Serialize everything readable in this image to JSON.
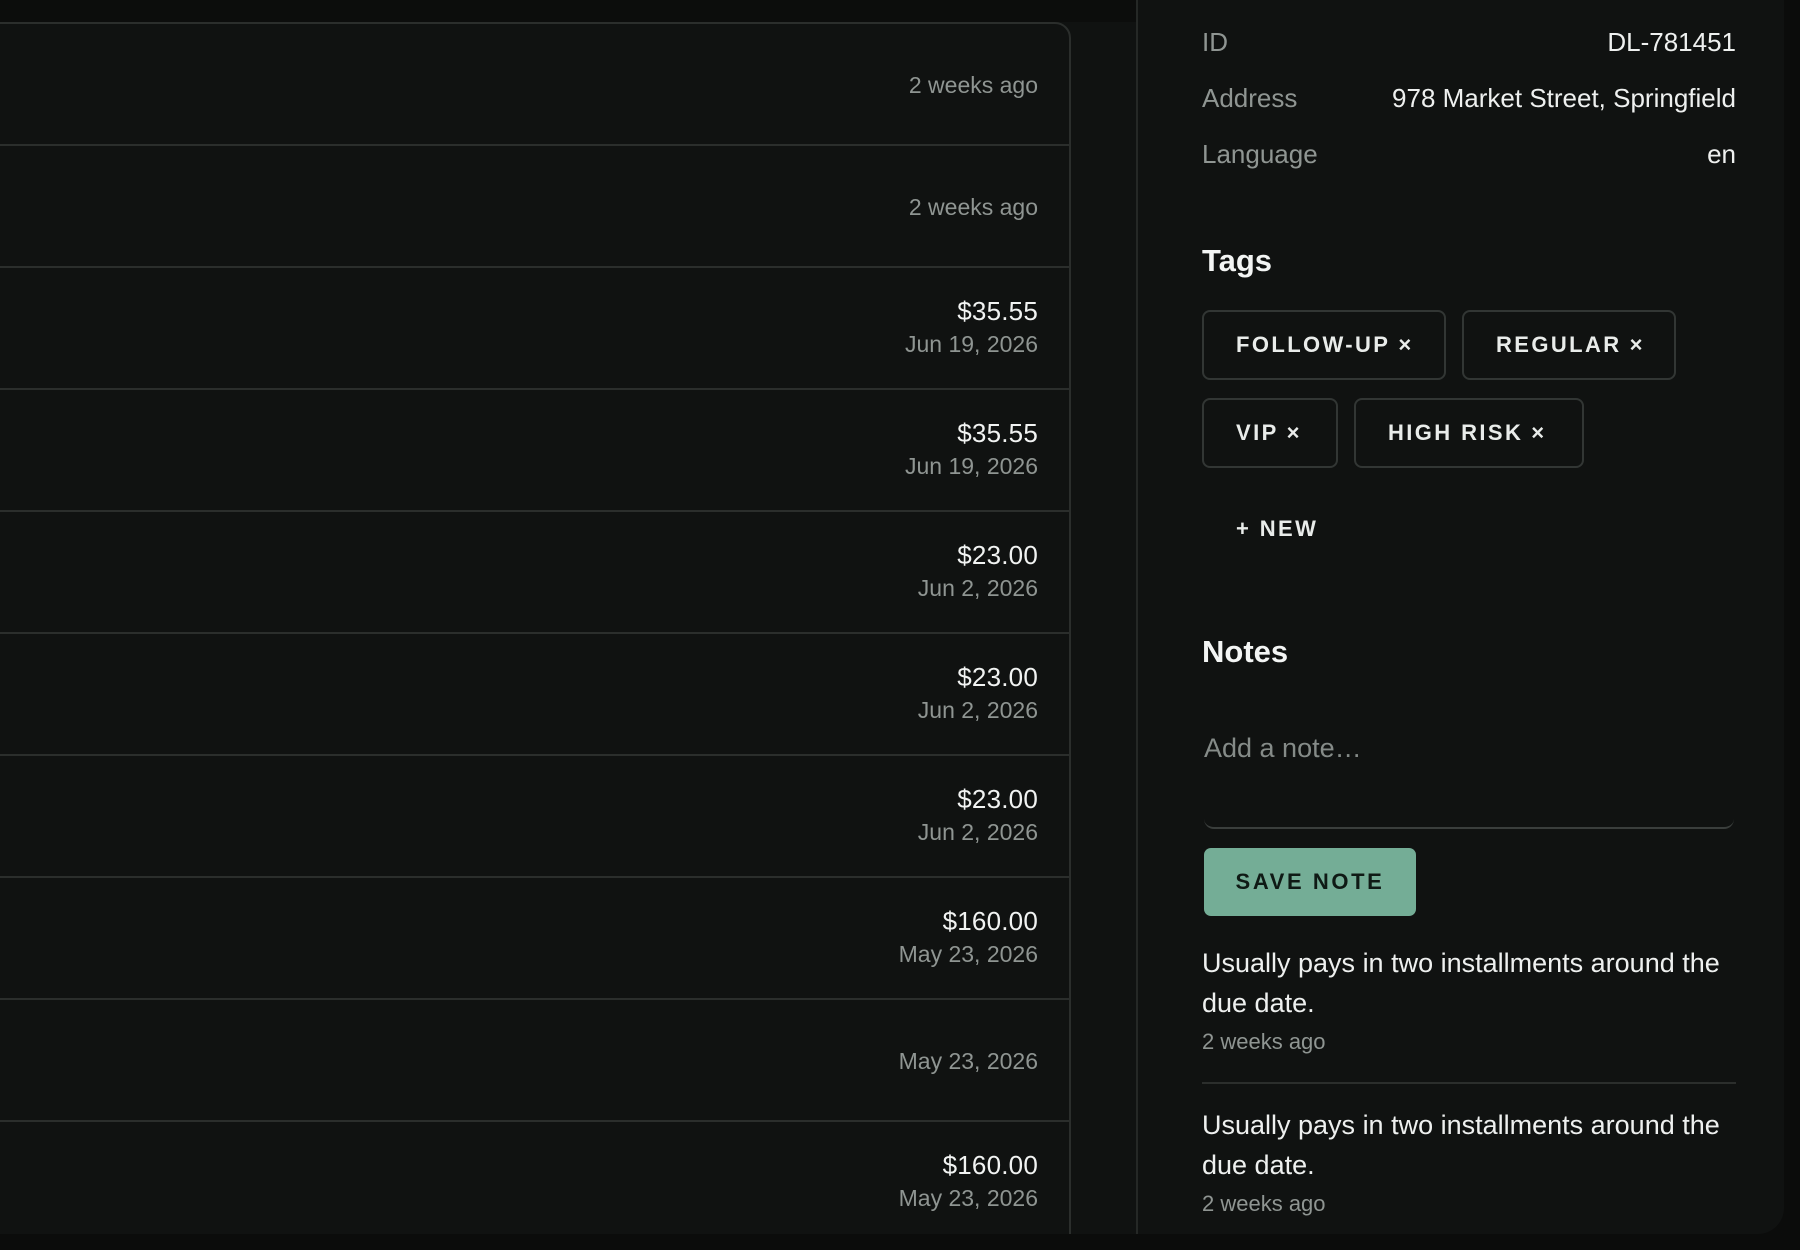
{
  "activity": {
    "rows": [
      {
        "amount": "",
        "date": "2 weeks ago"
      },
      {
        "amount": "",
        "date": "2 weeks ago"
      },
      {
        "amount": "$35.55",
        "date": "Jun 19, 2026"
      },
      {
        "amount": "$35.55",
        "date": "Jun 19, 2026"
      },
      {
        "amount": "$23.00",
        "date": "Jun 2, 2026"
      },
      {
        "amount": "$23.00",
        "date": "Jun 2, 2026"
      },
      {
        "amount": "$23.00",
        "date": "Jun 2, 2026"
      },
      {
        "amount": "$160.00",
        "date": "May 23, 2026"
      },
      {
        "amount": "",
        "date": "May 23, 2026"
      },
      {
        "amount": "$160.00",
        "date": "May 23, 2026"
      }
    ]
  },
  "details": {
    "fields": [
      {
        "key": "ID",
        "value": "DL-781451"
      },
      {
        "key": "Address",
        "value": "978 Market Street, Springfield"
      },
      {
        "key": "Language",
        "value": "en"
      }
    ]
  },
  "tags": {
    "heading": "Tags",
    "items": [
      {
        "label": "FOLLOW-UP",
        "remove": "×"
      },
      {
        "label": "REGULAR",
        "remove": "×"
      },
      {
        "label": "VIP",
        "remove": "×"
      },
      {
        "label": "HIGH RISK",
        "remove": "×"
      }
    ],
    "new_label": "+ NEW"
  },
  "notes": {
    "heading": "Notes",
    "placeholder": "Add a note…",
    "save_label": "SAVE NOTE",
    "items": [
      {
        "text": "Usually pays in two installments around the due date.",
        "time": "2 weeks ago"
      },
      {
        "text": "Usually pays in two installments around the due date.",
        "time": "2 weeks ago"
      }
    ]
  },
  "colors": {
    "background": "#101211",
    "accent": "#74ad96",
    "border": "#2b2e2c",
    "muted_text": "#8f9592"
  }
}
